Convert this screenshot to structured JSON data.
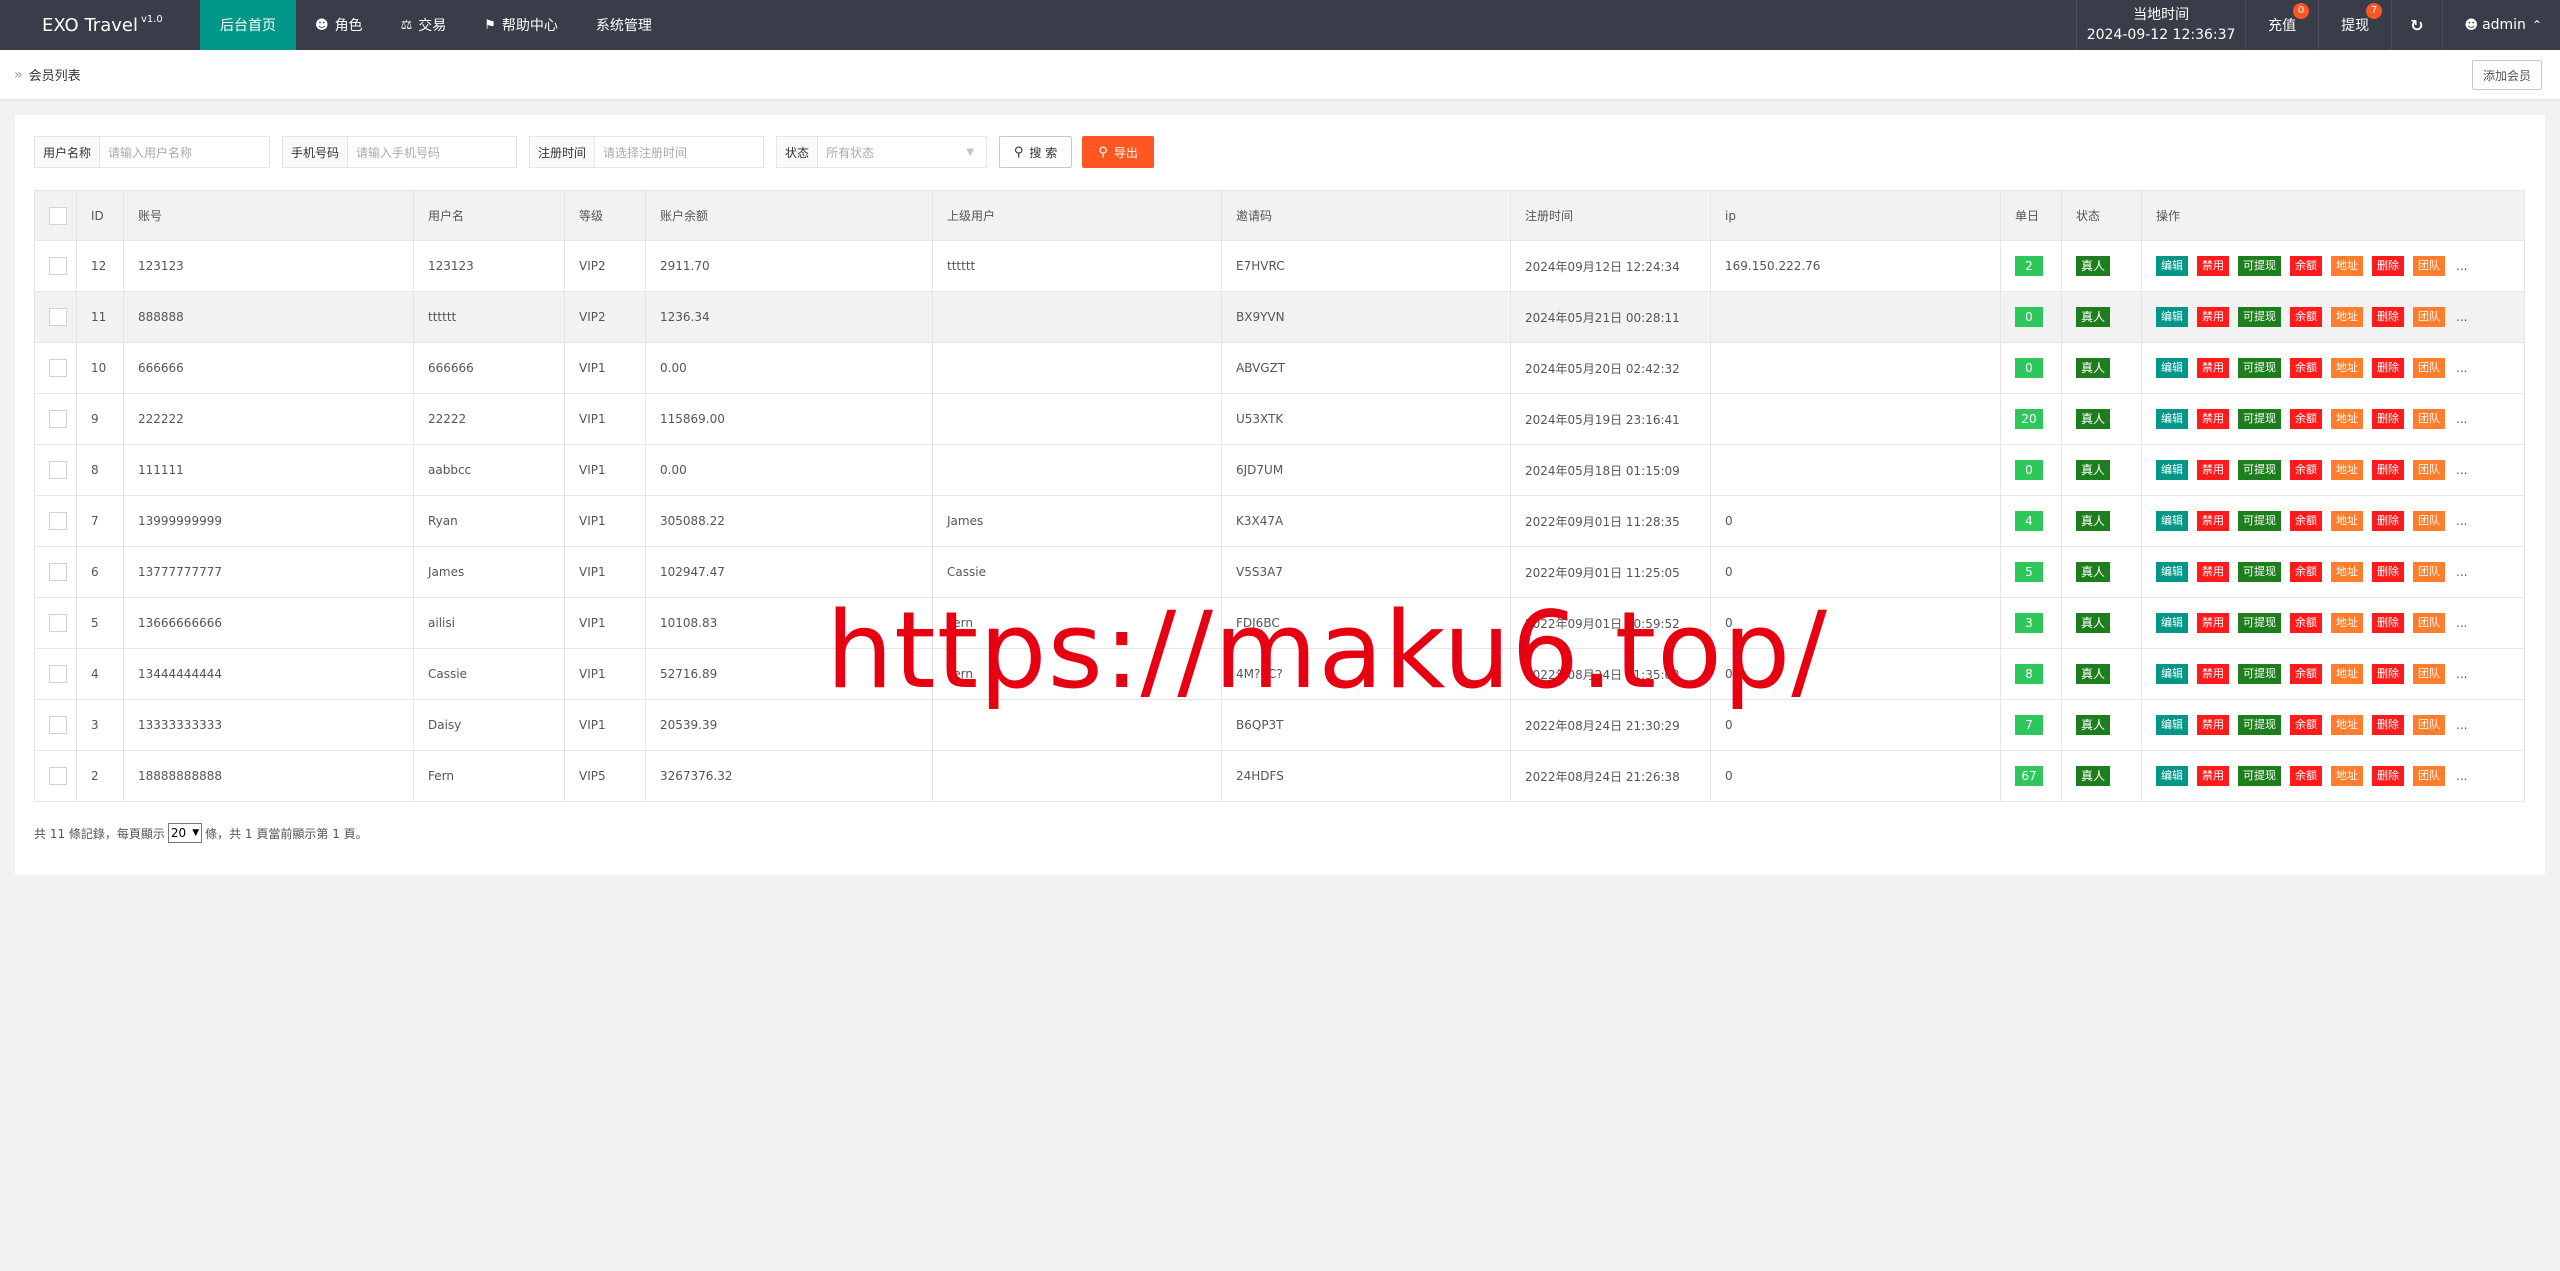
{
  "app": {
    "title": "EXO Travel",
    "version": "v1.0"
  },
  "nav": [
    {
      "label": "后台首页",
      "icon": ""
    },
    {
      "label": "角色",
      "icon": "user-icon"
    },
    {
      "label": "交易",
      "icon": "scale-icon"
    },
    {
      "label": "帮助中心",
      "icon": "flag-icon"
    },
    {
      "label": "系统管理",
      "icon": ""
    }
  ],
  "header": {
    "clock_label": "当地时间",
    "clock_value": "2024-09-12 12:36:37",
    "recharge": {
      "label": "充值",
      "badge": "0"
    },
    "withdraw": {
      "label": "提现",
      "badge": "7"
    },
    "refresh_icon": "refresh-icon",
    "user": "admin"
  },
  "breadcrumb": {
    "label": "会员列表",
    "add_button": "添加会员"
  },
  "filters": {
    "username": {
      "label": "用户名称",
      "placeholder": "请输入用户名称"
    },
    "phone": {
      "label": "手机号码",
      "placeholder": "请输入手机号码"
    },
    "regtime": {
      "label": "注册时间",
      "placeholder": "请选择注册时间"
    },
    "status": {
      "label": "状态",
      "value": "所有状态"
    },
    "search_button": "搜 索",
    "export_button": "导出"
  },
  "table": {
    "headers": [
      "ID",
      "账号",
      "用户名",
      "等级",
      "账户余额",
      "上级用户",
      "邀请码",
      "注册时间",
      "ip",
      "单日",
      "状态",
      "操作"
    ],
    "ops": [
      "编辑",
      "禁用",
      "可提现",
      "余额",
      "地址",
      "删除",
      "团队",
      "..."
    ],
    "rows": [
      {
        "id": "12",
        "account": "123123",
        "username": "123123",
        "level": "VIP2",
        "balance": "2911.70",
        "parent": "tttttt",
        "code": "E7HVRC",
        "regtime": "2024年09月12日 12:24:34",
        "ip": "169.150.222.76",
        "daily": "2",
        "status": "真人"
      },
      {
        "id": "11",
        "account": "888888",
        "username": "tttttt",
        "level": "VIP2",
        "balance": "1236.34",
        "parent": "",
        "code": "BX9YVN",
        "regtime": "2024年05月21日 00:28:11",
        "ip": "",
        "daily": "0",
        "status": "真人"
      },
      {
        "id": "10",
        "account": "666666",
        "username": "666666",
        "level": "VIP1",
        "balance": "0.00",
        "parent": "",
        "code": "ABVGZT",
        "regtime": "2024年05月20日 02:42:32",
        "ip": "",
        "daily": "0",
        "status": "真人"
      },
      {
        "id": "9",
        "account": "222222",
        "username": "22222",
        "level": "VIP1",
        "balance": "115869.00",
        "parent": "",
        "code": "U53XTK",
        "regtime": "2024年05月19日 23:16:41",
        "ip": "",
        "daily": "20",
        "status": "真人"
      },
      {
        "id": "8",
        "account": "111111",
        "username": "aabbcc",
        "level": "VIP1",
        "balance": "0.00",
        "parent": "",
        "code": "6JD7UM",
        "regtime": "2024年05月18日 01:15:09",
        "ip": "",
        "daily": "0",
        "status": "真人"
      },
      {
        "id": "7",
        "account": "13999999999",
        "username": "Ryan",
        "level": "VIP1",
        "balance": "305088.22",
        "parent": "James",
        "code": "K3X47A",
        "regtime": "2022年09月01日 11:28:35",
        "ip": "0",
        "daily": "4",
        "status": "真人"
      },
      {
        "id": "6",
        "account": "13777777777",
        "username": "James",
        "level": "VIP1",
        "balance": "102947.47",
        "parent": "Cassie",
        "code": "V5S3A7",
        "regtime": "2022年09月01日 11:25:05",
        "ip": "0",
        "daily": "5",
        "status": "真人"
      },
      {
        "id": "5",
        "account": "13666666666",
        "username": "ailisi",
        "level": "VIP1",
        "balance": "10108.83",
        "parent": "Fern",
        "code": "FDJ6BC",
        "regtime": "2022年09月01日 10:59:52",
        "ip": "0",
        "daily": "3",
        "status": "真人"
      },
      {
        "id": "4",
        "account": "13444444444",
        "username": "Cassie",
        "level": "VIP1",
        "balance": "52716.89",
        "parent": "Fern",
        "code": "4M?8C?",
        "regtime": "2022年08月24日 21:35:02",
        "ip": "0",
        "daily": "8",
        "status": "真人"
      },
      {
        "id": "3",
        "account": "13333333333",
        "username": "Daisy",
        "level": "VIP1",
        "balance": "20539.39",
        "parent": "",
        "code": "B6QP3T",
        "regtime": "2022年08月24日 21:30:29",
        "ip": "0",
        "daily": "7",
        "status": "真人"
      },
      {
        "id": "2",
        "account": "18888888888",
        "username": "Fern",
        "level": "VIP5",
        "balance": "3267376.32",
        "parent": "",
        "code": "24HDFS",
        "regtime": "2022年08月24日 21:26:38",
        "ip": "0",
        "daily": "67",
        "status": "真人"
      }
    ]
  },
  "pager": {
    "prefix": "共 11 條記錄，每頁顯示",
    "per_page": "20",
    "suffix": "條，共 1 頁當前顯示第 1 頁。"
  },
  "watermark": "https://maku6.top/",
  "colors": {
    "topbar": "#393d49",
    "accent": "#009688",
    "danger": "#ff1b1b",
    "warm": "#ff7e2d",
    "success": "#1e7e1e",
    "export": "#ff5722"
  }
}
